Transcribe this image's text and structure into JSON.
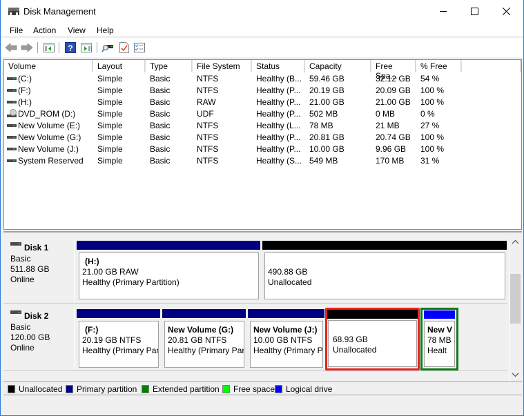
{
  "window": {
    "title": "Disk Management",
    "app_icon": "disk-management-icon",
    "controls": {
      "minimize": "minimize-icon",
      "maximize": "maximize-icon",
      "close": "close-icon"
    }
  },
  "menu": [
    "File",
    "Action",
    "View",
    "Help"
  ],
  "toolbar": [
    {
      "name": "back-button",
      "icon": "arrow-left-icon"
    },
    {
      "name": "forward-button",
      "icon": "arrow-right-icon"
    },
    {
      "name": "show-hide-console-tree-button",
      "icon": "console-tree-icon"
    },
    {
      "name": "help-button",
      "icon": "help-icon"
    },
    {
      "name": "show-hide-action-pane-button",
      "icon": "action-pane-icon"
    },
    {
      "name": "rescan-disks-button",
      "icon": "rescan-icon"
    },
    {
      "name": "properties-button",
      "icon": "properties-check-icon"
    },
    {
      "name": "settings-list-button",
      "icon": "checklist-icon"
    }
  ],
  "volume_list": {
    "columns": [
      "Volume",
      "Layout",
      "Type",
      "File System",
      "Status",
      "Capacity",
      "Free Spa...",
      "% Free"
    ],
    "rows": [
      {
        "icon": "drive-icon",
        "volume": "(C:)",
        "layout": "Simple",
        "type": "Basic",
        "fs": "NTFS",
        "status": "Healthy (B...",
        "capacity": "59.46 GB",
        "free": "32.12 GB",
        "pct": "54 %"
      },
      {
        "icon": "drive-icon",
        "volume": "(F:)",
        "layout": "Simple",
        "type": "Basic",
        "fs": "NTFS",
        "status": "Healthy (P...",
        "capacity": "20.19 GB",
        "free": "20.09 GB",
        "pct": "100 %"
      },
      {
        "icon": "drive-icon",
        "volume": "(H:)",
        "layout": "Simple",
        "type": "Basic",
        "fs": "RAW",
        "status": "Healthy (P...",
        "capacity": "21.00 GB",
        "free": "21.00 GB",
        "pct": "100 %"
      },
      {
        "icon": "dvd-icon",
        "volume": "DVD_ROM (D:)",
        "layout": "Simple",
        "type": "Basic",
        "fs": "UDF",
        "status": "Healthy (P...",
        "capacity": "502 MB",
        "free": "0 MB",
        "pct": "0 %"
      },
      {
        "icon": "drive-icon",
        "volume": "New Volume (E:)",
        "layout": "Simple",
        "type": "Basic",
        "fs": "NTFS",
        "status": "Healthy (L...",
        "capacity": "78 MB",
        "free": "21 MB",
        "pct": "27 %"
      },
      {
        "icon": "drive-icon",
        "volume": "New Volume (G:)",
        "layout": "Simple",
        "type": "Basic",
        "fs": "NTFS",
        "status": "Healthy (P...",
        "capacity": "20.81 GB",
        "free": "20.74 GB",
        "pct": "100 %"
      },
      {
        "icon": "drive-icon",
        "volume": "New Volume (J:)",
        "layout": "Simple",
        "type": "Basic",
        "fs": "NTFS",
        "status": "Healthy (P...",
        "capacity": "10.00 GB",
        "free": "9.96 GB",
        "pct": "100 %"
      },
      {
        "icon": "drive-icon",
        "volume": "System Reserved",
        "layout": "Simple",
        "type": "Basic",
        "fs": "NTFS",
        "status": "Healthy (S...",
        "capacity": "549 MB",
        "free": "170 MB",
        "pct": "31 %"
      }
    ]
  },
  "disks": [
    {
      "name": "Disk 1",
      "type": "Basic",
      "size": "511.88 GB",
      "state": "Online",
      "partitions": [
        {
          "kind": "primary",
          "label": "(H:)",
          "line2": "21.00 GB RAW",
          "line3": "Healthy (Primary Partition)"
        },
        {
          "kind": "unallocated",
          "label": "",
          "line2": "490.88 GB",
          "line3": "Unallocated"
        }
      ]
    },
    {
      "name": "Disk 2",
      "type": "Basic",
      "size": "120.00 GB",
      "state": "Online",
      "partitions": [
        {
          "kind": "primary",
          "label": "(F:)",
          "line2": "20.19 GB NTFS",
          "line3": "Healthy (Primary Par"
        },
        {
          "kind": "primary",
          "label": "New Volume  (G:)",
          "line2": "20.81 GB NTFS",
          "line3": "Healthy (Primary Par"
        },
        {
          "kind": "primary",
          "label": "New Volume  (J:)",
          "line2": "10.00 GB NTFS",
          "line3": "Healthy (Primary P"
        },
        {
          "kind": "unallocated",
          "label": "",
          "line2": "68.93 GB",
          "line3": "Unallocated",
          "highlight": "#e8221b"
        },
        {
          "kind": "logical",
          "label": "New V",
          "line2": "78 MB",
          "line3": "Healtł",
          "highlight": "#0f7a1a"
        }
      ]
    }
  ],
  "legend": [
    {
      "label": "Unallocated",
      "color": "#000000"
    },
    {
      "label": "Primary partition",
      "color": "#000080"
    },
    {
      "label": "Extended partition",
      "color": "#008000"
    },
    {
      "label": "Free space",
      "color": "#00ff00"
    },
    {
      "label": "Logical drive",
      "color": "#0000ff"
    }
  ],
  "colors": {
    "primary": "#000080",
    "unallocated": "#000000",
    "logical": "#0000ff",
    "window_border": "#2b7bd4"
  }
}
